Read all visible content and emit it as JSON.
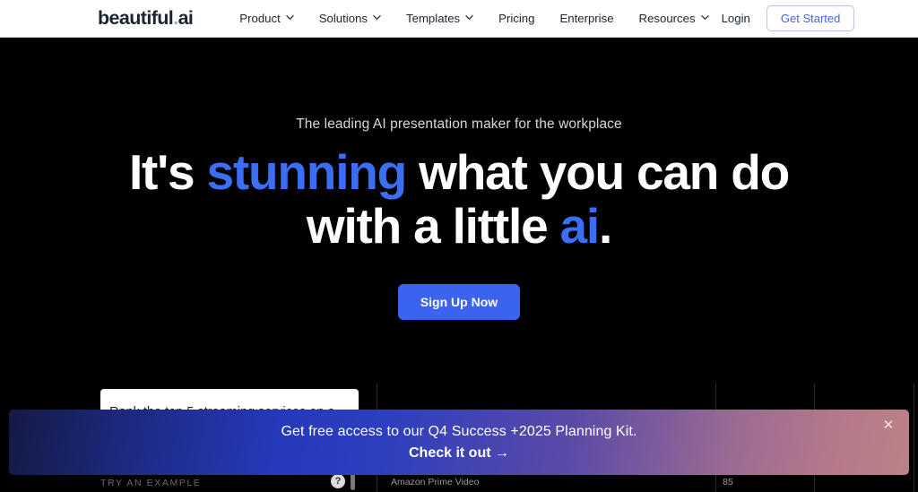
{
  "header": {
    "logo": {
      "main": "beautiful",
      "dot": ".",
      "suffix": "ai"
    },
    "nav": [
      {
        "label": "Product",
        "icon": "chevron-down-icon",
        "has_chevron": true
      },
      {
        "label": "Solutions",
        "icon": "chevron-down-icon",
        "has_chevron": true
      },
      {
        "label": "Templates",
        "icon": "chevron-down-icon",
        "has_chevron": true
      },
      {
        "label": "Pricing",
        "icon": "",
        "has_chevron": false
      },
      {
        "label": "Enterprise",
        "icon": "",
        "has_chevron": false
      },
      {
        "label": "Resources",
        "icon": "chevron-down-icon",
        "has_chevron": true
      }
    ],
    "login_label": "Login",
    "get_started_label": "Get Started",
    "get_started_color": "#4a63d8",
    "background": "#ffffff"
  },
  "hero": {
    "eyebrow": "The leading AI presentation maker for the workplace",
    "headline_line1_part1": "It's ",
    "headline_line1_accent": "stunning",
    "headline_line1_part2": " what you can do",
    "headline_line2_part1": "with a little ",
    "headline_line2_accent": "ai",
    "headline_line2_part2": ".",
    "accent_color": "#3b6ef5",
    "cta_label": "Sign Up Now",
    "cta_background": "#3b63f0",
    "background": "#000000"
  },
  "demo": {
    "prompt_value": "Rank the top 5 streaming services on a",
    "try_example_label": "TRY AN EXAMPLE",
    "help_icon_glyph": "?",
    "row_label": "Amazon Prime Video",
    "row_value": "85"
  },
  "banner": {
    "line1": "Get free access to our Q4 Success +2025 Planning Kit.",
    "line2": "Check it out  →",
    "close_glyph": "✕",
    "gradient_start": "#1d2a82",
    "gradient_mid": "#2e3fbe",
    "gradient_end": "#bb8286"
  }
}
